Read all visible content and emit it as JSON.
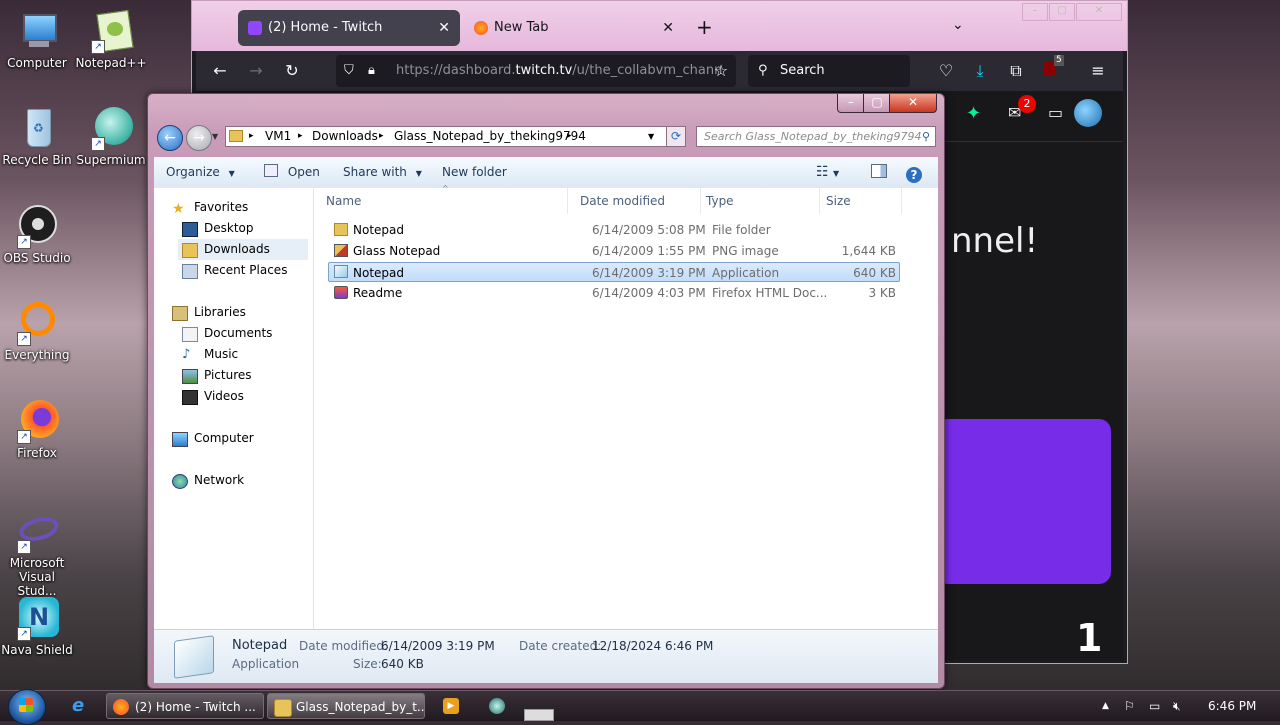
{
  "desktop": {
    "icons": [
      {
        "label": "Computer"
      },
      {
        "label": "Notepad++"
      },
      {
        "label": "Recycle Bin"
      },
      {
        "label": "Supermium"
      },
      {
        "label": "OBS Studio"
      },
      {
        "label": "Everything"
      },
      {
        "label": "Firefox"
      },
      {
        "label": "Microsoft Visual Stud..."
      },
      {
        "label": "Nava Shield"
      }
    ]
  },
  "firefox": {
    "tabs": [
      {
        "label": "(2) Home - Twitch"
      },
      {
        "label": "New Tab"
      }
    ],
    "url_prefix": "https://dashboard.",
    "url_domain": "twitch.tv",
    "url_suffix": "/u/the_collabvm_chann",
    "search_placeholder": "Search",
    "ublock_count": "5",
    "notification_count": "2",
    "page_text": "nnel!",
    "page_number": "1"
  },
  "explorer": {
    "breadcrumb": [
      "VM1",
      "Downloads",
      "Glass_Notepad_by_theking9794"
    ],
    "search_placeholder": "Search Glass_Notepad_by_theking9794",
    "toolbar": {
      "organize": "Organize",
      "open": "Open",
      "share_with": "Share with",
      "new_folder": "New folder"
    },
    "nav": {
      "favorites": "Favorites",
      "desktop": "Desktop",
      "downloads": "Downloads",
      "recent_places": "Recent Places",
      "libraries": "Libraries",
      "documents": "Documents",
      "music": "Music",
      "pictures": "Pictures",
      "videos": "Videos",
      "computer": "Computer",
      "network": "Network"
    },
    "columns": {
      "name": "Name",
      "date": "Date modified",
      "type": "Type",
      "size": "Size"
    },
    "files": [
      {
        "name": "Notepad",
        "date": "6/14/2009 5:08 PM",
        "type": "File folder",
        "size": ""
      },
      {
        "name": "Glass Notepad",
        "date": "6/14/2009 1:55 PM",
        "type": "PNG image",
        "size": "1,644 KB"
      },
      {
        "name": "Notepad",
        "date": "6/14/2009 3:19 PM",
        "type": "Application",
        "size": "640 KB"
      },
      {
        "name": "Readme",
        "date": "6/14/2009 4:03 PM",
        "type": "Firefox HTML Doc...",
        "size": "3 KB"
      }
    ],
    "details": {
      "name": "Notepad",
      "kind": "Application",
      "date_modified_label": "Date modified:",
      "date_modified": "6/14/2009 3:19 PM",
      "date_created_label": "Date created:",
      "date_created": "12/18/2024 6:46 PM",
      "size_label": "Size:",
      "size": "640 KB"
    }
  },
  "taskbar": {
    "items": [
      {
        "label": "(2) Home - Twitch ..."
      },
      {
        "label": "Glass_Notepad_by_t..."
      }
    ],
    "clock": "6:46 PM"
  },
  "colors": {
    "twitch_purple": "#772ce8",
    "firefox_tabstrip": "#e6b8dc",
    "selection_border": "#7da2ce"
  }
}
